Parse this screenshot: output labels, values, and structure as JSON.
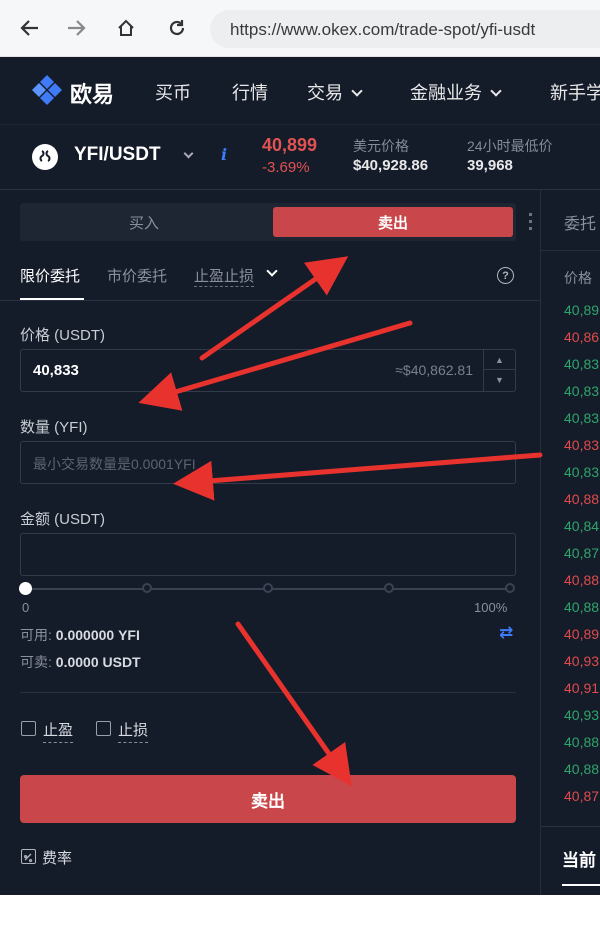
{
  "browser": {
    "url": "https://www.okex.com/trade-spot/yfi-usdt"
  },
  "header": {
    "logo_text": "欧易",
    "menu": [
      "买币",
      "行情",
      "交易",
      "金融业务",
      "新手学"
    ]
  },
  "ticker": {
    "pair": "YFI/USDT",
    "last_price": "40,899",
    "change": "-3.69%",
    "usd_price_label": "美元价格",
    "usd_price_value": "$40,928.86",
    "low_24h_label": "24小时最低价",
    "low_24h_value": "39,968"
  },
  "trade": {
    "buy_label": "买入",
    "sell_label": "卖出",
    "tabs": [
      "限价委托",
      "市价委托",
      "止盈止损"
    ],
    "price_label": "价格 (USDT)",
    "price_value": "40,833",
    "price_hint": "≈$40,862.81",
    "amount_label": "数量 (YFI)",
    "amount_placeholder": "最小交易数量是0.0001YFI",
    "total_label": "金额 (USDT)",
    "slider_min": "0",
    "slider_max": "100%",
    "slider_value": 0,
    "available_label": "可用:",
    "available_value": "0.000000 YFI",
    "sellable_label": "可卖:",
    "sellable_value": "0.0000 USDT",
    "take_profit_label": "止盈",
    "stop_loss_label": "止损",
    "submit_label": "卖出",
    "fee_label": "费率"
  },
  "orderbook": {
    "tab_label": "委托",
    "header": "价格",
    "rows": [
      {
        "price": "40,89",
        "side": "buy"
      },
      {
        "price": "40,86",
        "side": "sell"
      },
      {
        "price": "40,83",
        "side": "buy"
      },
      {
        "price": "40,83",
        "side": "buy"
      },
      {
        "price": "40,83",
        "side": "buy"
      },
      {
        "price": "40,83",
        "side": "sell"
      },
      {
        "price": "40,83",
        "side": "buy"
      },
      {
        "price": "40,88",
        "side": "sell"
      },
      {
        "price": "40,84",
        "side": "buy"
      },
      {
        "price": "40,87",
        "side": "buy"
      },
      {
        "price": "40,88",
        "side": "sell"
      },
      {
        "price": "40,88",
        "side": "buy"
      },
      {
        "price": "40,89",
        "side": "sell"
      },
      {
        "price": "40,93",
        "side": "sell"
      },
      {
        "price": "40,91",
        "side": "sell"
      },
      {
        "price": "40,93",
        "side": "buy"
      },
      {
        "price": "40,88",
        "side": "buy"
      },
      {
        "price": "40,88",
        "side": "buy"
      },
      {
        "price": "40,87",
        "side": "sell"
      }
    ],
    "current_tab": "当前"
  },
  "colors": {
    "sell": "#c9474a",
    "buy_text": "#2fa56b",
    "sell_text": "#e04b4b",
    "annotation": "#e8322e",
    "background": "#141b29"
  }
}
